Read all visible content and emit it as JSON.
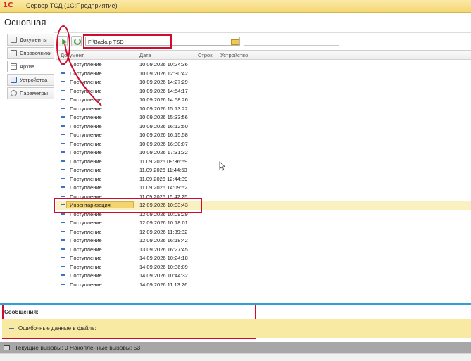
{
  "window": {
    "logo": "1С",
    "title": "Сервер ТСД  (1С:Предприятие)"
  },
  "page": {
    "title": "Основная"
  },
  "sidebar": {
    "tabs": [
      {
        "label": "Документы",
        "icon": "document-icon"
      },
      {
        "label": "Справочники",
        "icon": "catalog-icon"
      },
      {
        "label": "Архив",
        "icon": "archive-icon",
        "active": true
      },
      {
        "label": "Устройства",
        "icon": "device-icon"
      },
      {
        "label": "Параметры",
        "icon": "gear-icon"
      }
    ]
  },
  "toolbar": {
    "path_value": "F:\\Backup TSD",
    "extra_field_value": ""
  },
  "table": {
    "columns": {
      "document": "Документ",
      "date": "Дата",
      "line": "Строк",
      "device": "Устройство"
    },
    "rows": [
      {
        "document": "Поступление",
        "date": "10.09.2026  10:24:36"
      },
      {
        "document": "Поступление",
        "date": "10.09.2026  12:30:42"
      },
      {
        "document": "Поступление",
        "date": "10.09.2026  14:27:29"
      },
      {
        "document": "Поступление",
        "date": "10.09.2026  14:54:17"
      },
      {
        "document": "Поступление",
        "date": "10.09.2026  14:58:26"
      },
      {
        "document": "Поступление",
        "date": "10.09.2026  15:13:22"
      },
      {
        "document": "Поступление",
        "date": "10.09.2026  15:33:56"
      },
      {
        "document": "Поступление",
        "date": "10.09.2026  16:12:50"
      },
      {
        "document": "Поступление",
        "date": "10.09.2026  16:15:58"
      },
      {
        "document": "Поступление",
        "date": "10.09.2026  16:30:07"
      },
      {
        "document": "Поступление",
        "date": "10.09.2026  17:31:32"
      },
      {
        "document": "Поступление",
        "date": "11.09.2026  09:36:59"
      },
      {
        "document": "Поступление",
        "date": "11.09.2026  11:44:53"
      },
      {
        "document": "Поступление",
        "date": "11.09.2026  12:44:39"
      },
      {
        "document": "Поступление",
        "date": "11.09.2026  14:09:52"
      },
      {
        "document": "Поступление",
        "date": "11.09.2026  15:42:25"
      },
      {
        "document": "Инвентаризация",
        "date": "12.09.2026  10:03:43",
        "selected": true
      },
      {
        "document": "Поступление",
        "date": "12.09.2026  10:09:29"
      },
      {
        "document": "Поступление",
        "date": "12.09.2026  10:18:01"
      },
      {
        "document": "Поступление",
        "date": "12.09.2026  11:39:32"
      },
      {
        "document": "Поступление",
        "date": "12.09.2026  16:18:42"
      },
      {
        "document": "Поступление",
        "date": "13.09.2026  16:27:45"
      },
      {
        "document": "Поступление",
        "date": "14.09.2026  10:24:18"
      },
      {
        "document": "Поступление",
        "date": "14.09.2026  10:36:09"
      },
      {
        "document": "Поступление",
        "date": "14.09.2026  10:44:32"
      },
      {
        "document": "Поступление",
        "date": "14.09.2026  11:13:26"
      }
    ]
  },
  "messages": {
    "title": "Сообщения:",
    "items": [
      "Ошибочные данные в файле:"
    ]
  },
  "status": {
    "text": "Текущие вызовы: 0    Накопленные вызовы: 53"
  },
  "colors": {
    "annotation": "#d10b2d",
    "accent_bar": "#2ea0d8",
    "selection": "#f4d46e"
  }
}
